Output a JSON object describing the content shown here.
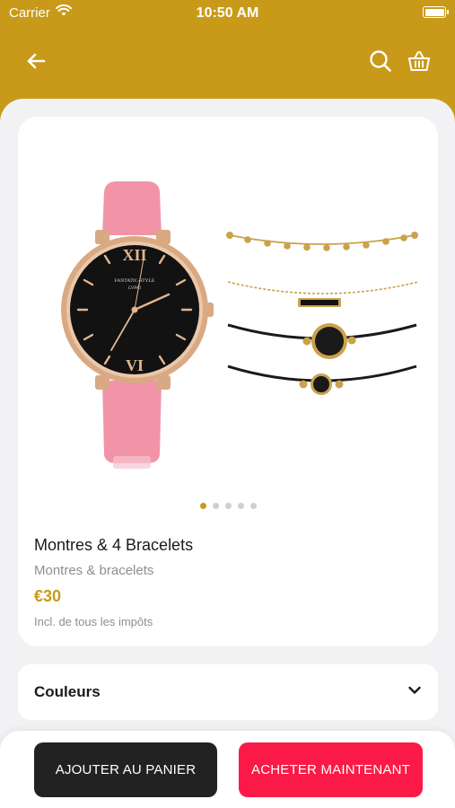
{
  "status_bar": {
    "carrier": "Carrier",
    "time": "10:50 AM"
  },
  "header": {
    "back_icon": "arrow-left-icon",
    "search_icon": "search-icon",
    "cart_icon": "basket-icon"
  },
  "product": {
    "title": "Montres & 4 Bracelets",
    "category": "Montres & bracelets",
    "price": "€30",
    "tax_note": "Incl. de tous les impôts",
    "image_count": 5,
    "active_image": 1,
    "watch_brand": "FANTATIC-STYLE",
    "watch_model": "LVPAI"
  },
  "colors_section": {
    "label": "Couleurs",
    "icon": "chevron-down-icon"
  },
  "actions": {
    "add_to_cart": "AJOUTER AU PANIER",
    "buy_now": "ACHETER MAINTENANT"
  },
  "colors": {
    "accent": "#c99a1a",
    "buy_button": "#fb1a47",
    "cart_button": "#222222",
    "background": "#f2f2f4"
  }
}
